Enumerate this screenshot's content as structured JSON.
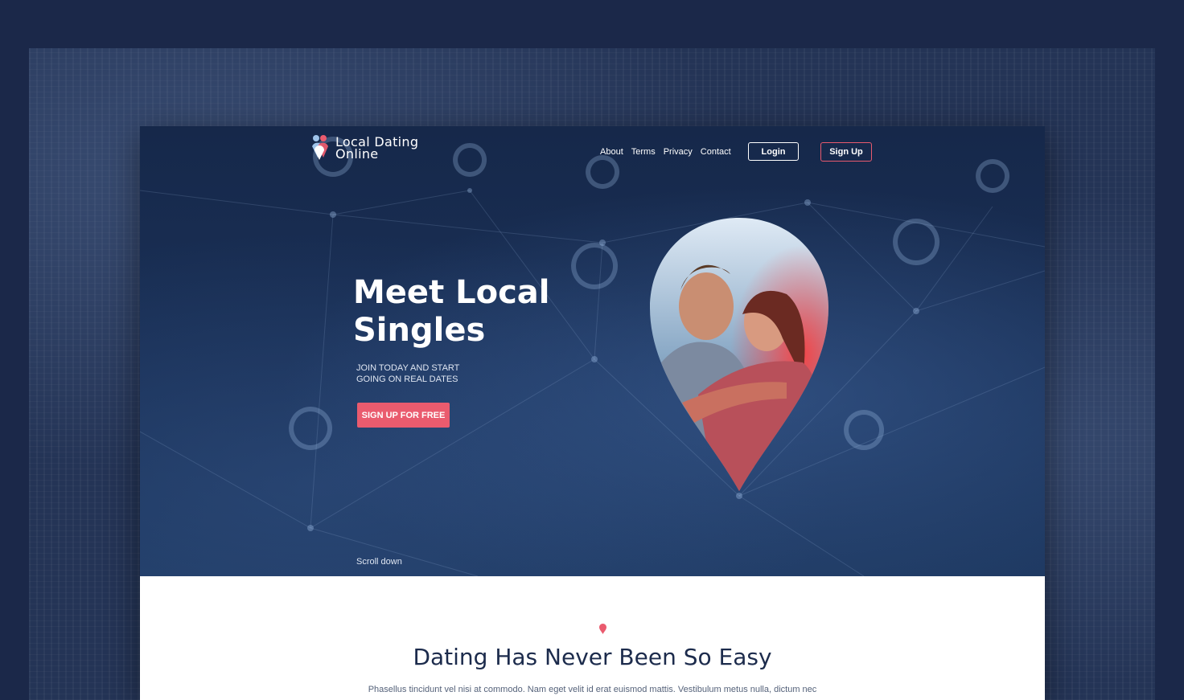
{
  "brand": {
    "line1": "Local Dating",
    "line2": "Online"
  },
  "nav": {
    "items": [
      "About",
      "Terms",
      "Privacy",
      "Contact"
    ],
    "login": "Login",
    "signup": "Sign Up"
  },
  "hero": {
    "title_line1": "Meet Local",
    "title_line2": "Singles",
    "subtitle_line1": "JOIN TODAY AND START",
    "subtitle_line2": "GOING ON REAL DATES",
    "cta": "SIGN UP FOR FREE",
    "scroll": "Scroll down",
    "photo_icon": "couple-photo-in-map-pin"
  },
  "section": {
    "title": "Dating Has Never Been So Easy",
    "text": "Phasellus tincidunt vel nisi at commodo. Nam eget velit id erat euismod mattis. Vestibulum metus nulla, dictum nec"
  },
  "colors": {
    "accent": "#ea5b6e",
    "navy": "#1c2b4c",
    "hero": "#1a3158"
  }
}
